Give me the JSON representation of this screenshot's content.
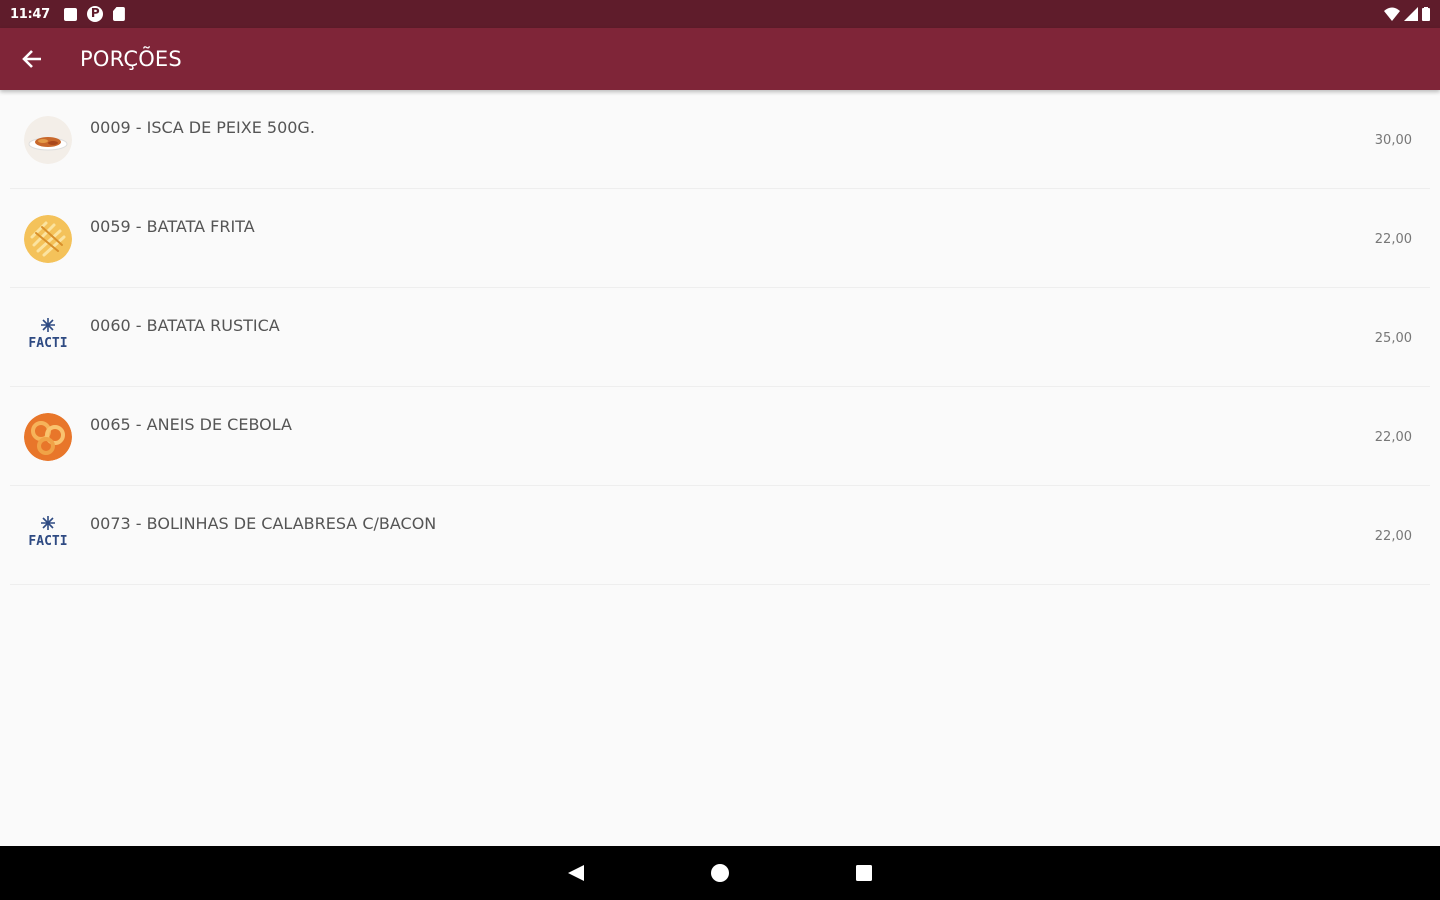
{
  "status_bar": {
    "time": "11:47"
  },
  "app_bar": {
    "title": "PORÇÕES",
    "color": "#7f2538",
    "status_color": "#5f1c2b"
  },
  "items": [
    {
      "name": "0009 - ISCA DE PEIXE 500G.",
      "price": "30,00",
      "thumb": "fish-photo"
    },
    {
      "name": "0059 - BATATA FRITA",
      "price": "22,00",
      "thumb": "fries-photo"
    },
    {
      "name": "0060 - BATATA RUSTICA",
      "price": "25,00",
      "thumb": "facti-logo"
    },
    {
      "name": "0065 - ANEIS DE CEBOLA",
      "price": "22,00",
      "thumb": "onion-rings-photo"
    },
    {
      "name": "0073 - BOLINHAS DE CALABRESA C/BACON",
      "price": "22,00",
      "thumb": "facti-logo"
    }
  ],
  "logo_text": "FACTI"
}
